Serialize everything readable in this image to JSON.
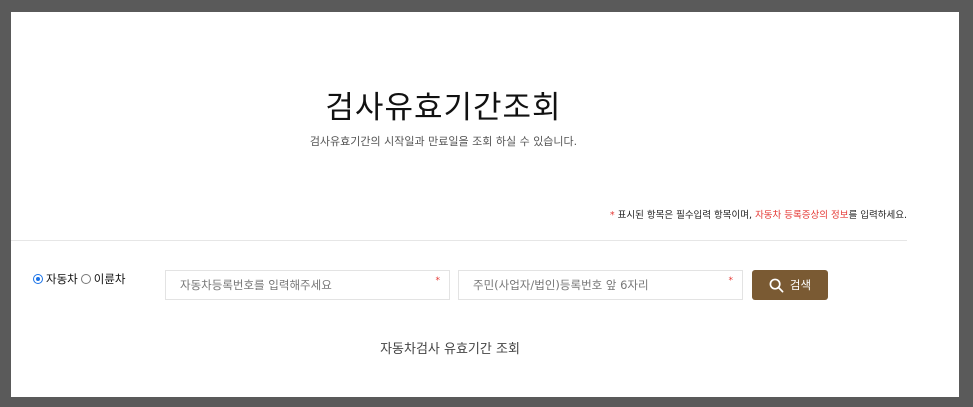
{
  "page": {
    "title": "검사유효기간조회",
    "subtitle": "검사유효기간의 시작일과 만료일을 조회 하실 수 있습니다."
  },
  "notice": {
    "star": "*",
    "text_before": "표시된 항목은 필수입력 항목이며, ",
    "highlight": "자동차 등록증상의 정보",
    "text_after": "를 입력하세요.",
    "highlight_color": "#e53935"
  },
  "vehicle_type": {
    "options": [
      {
        "label": "자동차",
        "checked": true
      },
      {
        "label": "이륜차",
        "checked": false
      }
    ]
  },
  "search": {
    "car_number_placeholder": "자동차등록번호를 입력해주세요",
    "car_number_value": "",
    "id_number_placeholder": "주민(사업자/법인)등록번호 앞 6자리",
    "id_number_value": "",
    "required_mark": "*",
    "button_label": "검색",
    "button_icon": "search-icon",
    "button_color": "#7a5a33"
  },
  "result": {
    "caption": "자동차검사 유효기간 조회"
  }
}
